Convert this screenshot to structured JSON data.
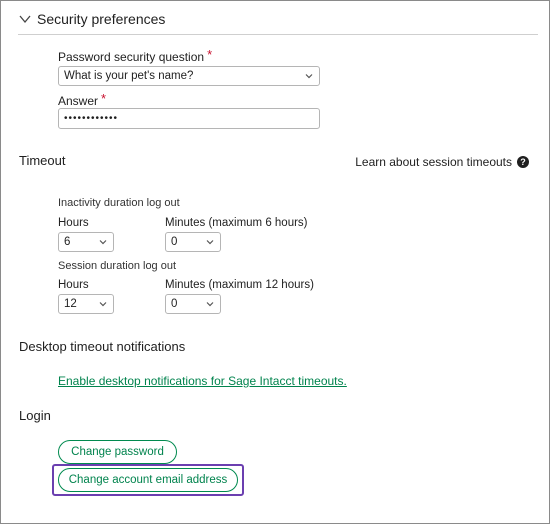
{
  "security": {
    "title": "Security preferences",
    "question_label": "Password security question",
    "question_value": "What is your pet's name?",
    "answer_label": "Answer",
    "answer_value": "••••••••••••",
    "required_mark": "*"
  },
  "timeout": {
    "title": "Timeout",
    "help_link": "Learn about session timeouts",
    "help_icon": "?",
    "inactivity_label": "Inactivity duration log out",
    "session_label": "Session duration log out",
    "hours_label": "Hours",
    "minutes_inactivity_label": "Minutes (maximum 6 hours)",
    "minutes_session_label": "Minutes (maximum 12 hours)",
    "inactivity_hours": "6",
    "inactivity_minutes": "0",
    "session_hours": "12",
    "session_minutes": "0"
  },
  "desktop": {
    "title": "Desktop timeout notifications",
    "link": "Enable desktop notifications for Sage Intacct timeouts."
  },
  "login": {
    "title": "Login",
    "change_password": "Change password",
    "change_email": "Change account email address"
  },
  "colors": {
    "accent": "#00834d",
    "required": "#c8102e",
    "highlight": "#6b3fb0"
  }
}
